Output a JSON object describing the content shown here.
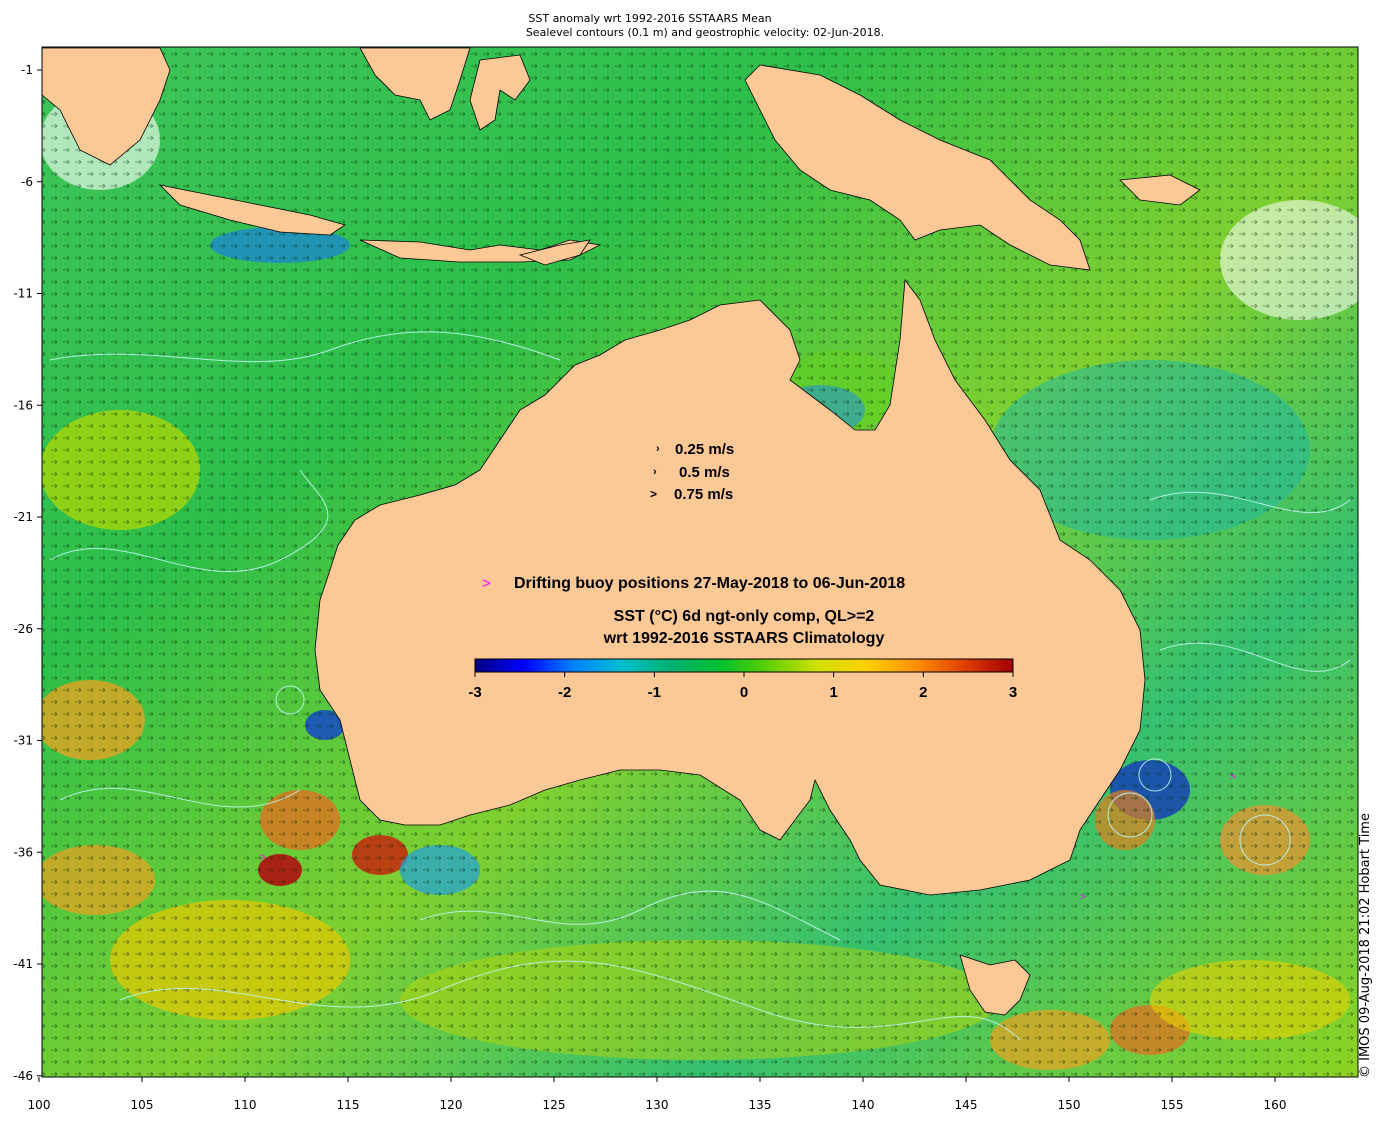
{
  "title_line1": "SST anomaly wrt 1992-2016 SSTAARS Mean",
  "title_line2": "Sealevel contours (0.1 m) and geostrophic velocity: 02-Jun-2018.",
  "axes": {
    "x_ticks": [
      "100",
      "105",
      "110",
      "115",
      "120",
      "125",
      "130",
      "135",
      "140",
      "145",
      "150",
      "155",
      "160"
    ],
    "y_ticks": [
      "-1",
      "-6",
      "-11",
      "-16",
      "-21",
      "-26",
      "-31",
      "-36",
      "-41",
      "-46"
    ],
    "lon_range": [
      100,
      165
    ],
    "lat_range": [
      -46,
      1
    ]
  },
  "velocity_legend": [
    {
      "label": "0.25 m/s",
      "symbol": "›"
    },
    {
      "label": "0.5 m/s",
      "symbol": "›"
    },
    {
      "label": "0.75 m/s",
      "symbol": ">"
    }
  ],
  "buoy_legend": {
    "symbol": ">",
    "label": "Drifting buoy positions 27-May-2018 to 06-Jun-2018",
    "color": "#ff00ff"
  },
  "colorbar": {
    "title_line1": "SST (°C) 6d ngt-only comp, QL>=2",
    "title_line2": "wrt 1992-2016 SSTAARS Climatology",
    "ticks": [
      "-3",
      "-2",
      "-1",
      "0",
      "1",
      "2",
      "3"
    ],
    "min": -3,
    "max": 3,
    "colors": [
      "#000080",
      "#0000ff",
      "#0080ff",
      "#00c0d0",
      "#00b070",
      "#00c030",
      "#60d000",
      "#d0e000",
      "#ffd000",
      "#ff9000",
      "#e04000",
      "#a00000"
    ]
  },
  "credit": "© IMOS 09-Aug-2018 21:02 Hobart Time",
  "colors": {
    "land": "#fbc896",
    "ocean_base": "#33c244",
    "ocean_warm": "#b8d800",
    "ocean_cool": "#19b890",
    "contour": "#bff5f0"
  }
}
